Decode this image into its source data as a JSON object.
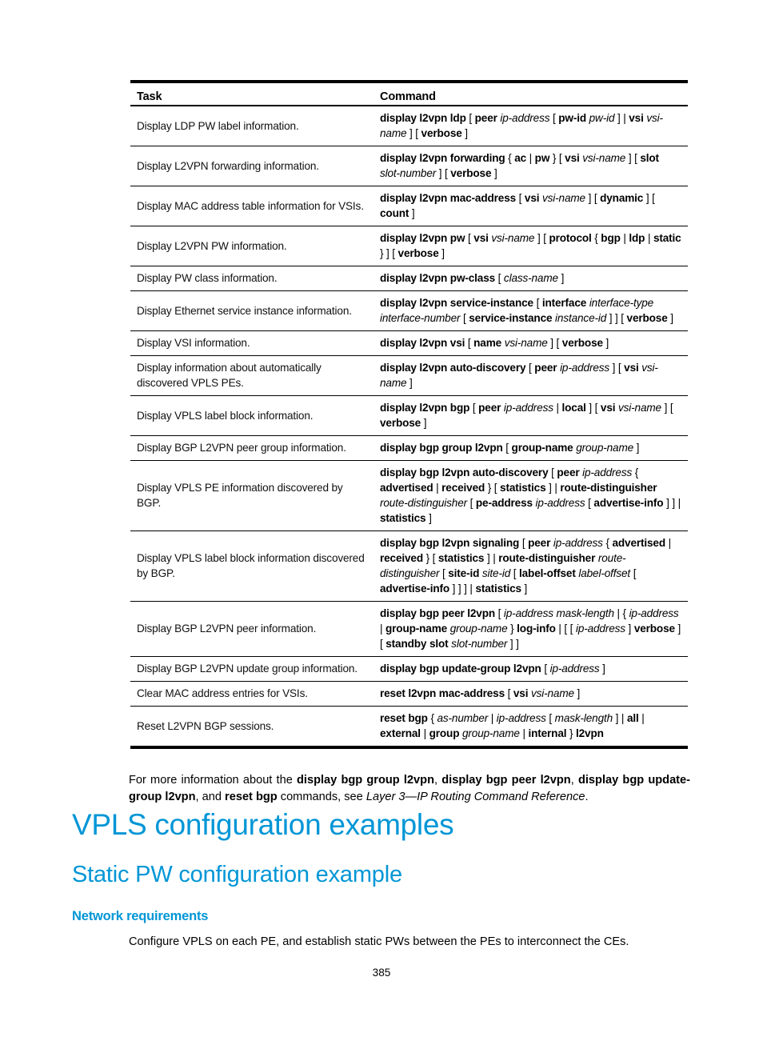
{
  "table": {
    "headers": {
      "task": "Task",
      "command": "Command"
    },
    "rows": [
      {
        "task": "Display LDP PW label information.",
        "command": [
          [
            "b",
            "display l2vpn ldp"
          ],
          [
            "t",
            " [ "
          ],
          [
            "b",
            "peer"
          ],
          [
            "t",
            " "
          ],
          [
            "i",
            "ip-address"
          ],
          [
            "t",
            " [ "
          ],
          [
            "b",
            "pw-id"
          ],
          [
            "t",
            " "
          ],
          [
            "i",
            "pw-id"
          ],
          [
            "t",
            " ] | "
          ],
          [
            "b",
            "vsi"
          ],
          [
            "t",
            " "
          ],
          [
            "i",
            "vsi-name"
          ],
          [
            "t",
            " ] [ "
          ],
          [
            "b",
            "verbose"
          ],
          [
            "t",
            " ]"
          ]
        ]
      },
      {
        "task": "Display L2VPN forwarding information.",
        "command": [
          [
            "b",
            "display l2vpn forwarding"
          ],
          [
            "t",
            " { "
          ],
          [
            "b",
            "ac"
          ],
          [
            "t",
            " | "
          ],
          [
            "b",
            "pw"
          ],
          [
            "t",
            " } [ "
          ],
          [
            "b",
            "vsi"
          ],
          [
            "t",
            " "
          ],
          [
            "i",
            "vsi-name"
          ],
          [
            "t",
            " ] [ "
          ],
          [
            "b",
            "slot"
          ],
          [
            "t",
            " "
          ],
          [
            "i",
            "slot-number"
          ],
          [
            "t",
            " ] [ "
          ],
          [
            "b",
            "verbose"
          ],
          [
            "t",
            " ]"
          ]
        ]
      },
      {
        "task": "Display MAC address table information for VSIs.",
        "command": [
          [
            "b",
            "display l2vpn mac-address"
          ],
          [
            "t",
            " [ "
          ],
          [
            "b",
            "vsi"
          ],
          [
            "t",
            " "
          ],
          [
            "i",
            "vsi-name"
          ],
          [
            "t",
            " ] [ "
          ],
          [
            "b",
            "dynamic"
          ],
          [
            "t",
            " ] [ "
          ],
          [
            "b",
            "count"
          ],
          [
            "t",
            " ]"
          ]
        ]
      },
      {
        "task": "Display L2VPN PW information.",
        "command": [
          [
            "b",
            "display l2vpn pw"
          ],
          [
            "t",
            " [ "
          ],
          [
            "b",
            "vsi"
          ],
          [
            "t",
            " "
          ],
          [
            "i",
            "vsi-name"
          ],
          [
            "t",
            " ] [ "
          ],
          [
            "b",
            "protocol"
          ],
          [
            "t",
            " { "
          ],
          [
            "b",
            "bgp"
          ],
          [
            "t",
            " | "
          ],
          [
            "b",
            "ldp"
          ],
          [
            "t",
            " | "
          ],
          [
            "b",
            "static"
          ],
          [
            "t",
            " } ] [ "
          ],
          [
            "b",
            "verbose"
          ],
          [
            "t",
            " ]"
          ]
        ]
      },
      {
        "task": "Display PW class information.",
        "command": [
          [
            "b",
            "display l2vpn pw-class"
          ],
          [
            "t",
            " [ "
          ],
          [
            "i",
            "class-name"
          ],
          [
            "t",
            " ]"
          ]
        ]
      },
      {
        "task": "Display Ethernet service instance information.",
        "command": [
          [
            "b",
            "display l2vpn service-instance"
          ],
          [
            "t",
            " [ "
          ],
          [
            "b",
            "interface"
          ],
          [
            "t",
            " "
          ],
          [
            "i",
            "interface-type interface-number"
          ],
          [
            "t",
            " [ "
          ],
          [
            "b",
            "service-instance"
          ],
          [
            "t",
            " "
          ],
          [
            "i",
            "instance-id"
          ],
          [
            "t",
            " ] ] [ "
          ],
          [
            "b",
            "verbose"
          ],
          [
            "t",
            " ]"
          ]
        ]
      },
      {
        "task": "Display VSI information.",
        "command": [
          [
            "b",
            "display l2vpn vsi"
          ],
          [
            "t",
            " [ "
          ],
          [
            "b",
            "name"
          ],
          [
            "t",
            " "
          ],
          [
            "i",
            "vsi-name"
          ],
          [
            "t",
            " ] [ "
          ],
          [
            "b",
            "verbose"
          ],
          [
            "t",
            " ]"
          ]
        ]
      },
      {
        "task": "Display information about automatically discovered VPLS PEs.",
        "command": [
          [
            "b",
            "display l2vpn auto-discovery"
          ],
          [
            "t",
            " [ "
          ],
          [
            "b",
            "peer"
          ],
          [
            "t",
            " "
          ],
          [
            "i",
            "ip-address"
          ],
          [
            "t",
            " ] [ "
          ],
          [
            "b",
            "vsi"
          ],
          [
            "t",
            " "
          ],
          [
            "i",
            "vsi-name"
          ],
          [
            "t",
            " ]"
          ]
        ]
      },
      {
        "task": "Display VPLS label block information.",
        "command": [
          [
            "b",
            "display l2vpn bgp"
          ],
          [
            "t",
            " [ "
          ],
          [
            "b",
            "peer"
          ],
          [
            "t",
            " "
          ],
          [
            "i",
            "ip-address"
          ],
          [
            "t",
            " | "
          ],
          [
            "b",
            "local"
          ],
          [
            "t",
            " ] [ "
          ],
          [
            "b",
            "vsi"
          ],
          [
            "t",
            " "
          ],
          [
            "i",
            "vsi-name"
          ],
          [
            "t",
            " ] [ "
          ],
          [
            "b",
            "verbose"
          ],
          [
            "t",
            " ]"
          ]
        ]
      },
      {
        "task": "Display BGP L2VPN peer group information.",
        "command": [
          [
            "b",
            "display bgp group l2vpn"
          ],
          [
            "t",
            " [ "
          ],
          [
            "b",
            "group-name"
          ],
          [
            "t",
            " "
          ],
          [
            "i",
            "group-name"
          ],
          [
            "t",
            " ]"
          ]
        ]
      },
      {
        "task": "Display VPLS PE information discovered by BGP.",
        "command": [
          [
            "b",
            "display bgp l2vpn auto-discovery"
          ],
          [
            "t",
            " [ "
          ],
          [
            "b",
            "peer"
          ],
          [
            "t",
            " "
          ],
          [
            "i",
            "ip-address"
          ],
          [
            "t",
            " { "
          ],
          [
            "b",
            "advertised"
          ],
          [
            "t",
            " | "
          ],
          [
            "b",
            "received"
          ],
          [
            "t",
            " } [ "
          ],
          [
            "b",
            "statistics"
          ],
          [
            "t",
            " ] | "
          ],
          [
            "b",
            "route-distinguisher"
          ],
          [
            "t",
            " "
          ],
          [
            "i",
            "route-distinguisher"
          ],
          [
            "t",
            " [ "
          ],
          [
            "b",
            "pe-address"
          ],
          [
            "t",
            " "
          ],
          [
            "i",
            "ip-address"
          ],
          [
            "t",
            " [ "
          ],
          [
            "b",
            "advertise-info"
          ],
          [
            "t",
            " ] ] | "
          ],
          [
            "b",
            "statistics"
          ],
          [
            "t",
            " ]"
          ]
        ]
      },
      {
        "task": "Display VPLS label block information discovered by BGP.",
        "command": [
          [
            "b",
            "display bgp l2vpn signaling"
          ],
          [
            "t",
            " [ "
          ],
          [
            "b",
            "peer"
          ],
          [
            "t",
            " "
          ],
          [
            "i",
            "ip-address"
          ],
          [
            "t",
            " { "
          ],
          [
            "b",
            "advertised"
          ],
          [
            "t",
            " | "
          ],
          [
            "b",
            "received"
          ],
          [
            "t",
            " } [ "
          ],
          [
            "b",
            "statistics"
          ],
          [
            "t",
            " ] | "
          ],
          [
            "b",
            "route-distinguisher"
          ],
          [
            "t",
            " "
          ],
          [
            "i",
            "route-distinguisher"
          ],
          [
            "t",
            " [ "
          ],
          [
            "b",
            "site-id"
          ],
          [
            "t",
            " "
          ],
          [
            "i",
            "site-id"
          ],
          [
            "t",
            " [ "
          ],
          [
            "b",
            "label-offset"
          ],
          [
            "t",
            " "
          ],
          [
            "i",
            "label-offset"
          ],
          [
            "t",
            " [ "
          ],
          [
            "b",
            "advertise-info"
          ],
          [
            "t",
            " ] ] ] | "
          ],
          [
            "b",
            "statistics"
          ],
          [
            "t",
            " ]"
          ]
        ]
      },
      {
        "task": "Display BGP L2VPN peer information.",
        "command": [
          [
            "b",
            "display bgp peer l2vpn"
          ],
          [
            "t",
            " [ "
          ],
          [
            "i",
            "ip-address mask-length"
          ],
          [
            "t",
            " | { "
          ],
          [
            "i",
            "ip-address"
          ],
          [
            "t",
            " | "
          ],
          [
            "b",
            "group-name"
          ],
          [
            "t",
            " "
          ],
          [
            "i",
            "group-name"
          ],
          [
            "t",
            " } "
          ],
          [
            "b",
            "log-info"
          ],
          [
            "t",
            " | [ [ "
          ],
          [
            "i",
            "ip-address"
          ],
          [
            "t",
            " ] "
          ],
          [
            "b",
            "verbose"
          ],
          [
            "t",
            " ] [ "
          ],
          [
            "b",
            "standby slot"
          ],
          [
            "t",
            " "
          ],
          [
            "i",
            "slot-number"
          ],
          [
            "t",
            " ] ]"
          ]
        ]
      },
      {
        "task": "Display BGP L2VPN update group information.",
        "command": [
          [
            "b",
            "display bgp update-group l2vpn"
          ],
          [
            "t",
            " [ "
          ],
          [
            "i",
            "ip-address"
          ],
          [
            "t",
            " ]"
          ]
        ]
      },
      {
        "task": "Clear MAC address entries for VSIs.",
        "command": [
          [
            "b",
            "reset l2vpn mac-address"
          ],
          [
            "t",
            " [ "
          ],
          [
            "b",
            "vsi"
          ],
          [
            "t",
            " "
          ],
          [
            "i",
            "vsi-name"
          ],
          [
            "t",
            " ]"
          ]
        ]
      },
      {
        "task": "Reset L2VPN BGP sessions.",
        "command": [
          [
            "b",
            "reset bgp"
          ],
          [
            "t",
            " { "
          ],
          [
            "i",
            "as-number"
          ],
          [
            "t",
            " | "
          ],
          [
            "i",
            "ip-address"
          ],
          [
            "t",
            " [ "
          ],
          [
            "i",
            "mask-length"
          ],
          [
            "t",
            " ] | "
          ],
          [
            "b",
            "all"
          ],
          [
            "t",
            " | "
          ],
          [
            "b",
            "external"
          ],
          [
            "t",
            " | "
          ],
          [
            "b",
            "group"
          ],
          [
            "t",
            " "
          ],
          [
            "i",
            "group-name"
          ],
          [
            "t",
            " | "
          ],
          [
            "b",
            "internal"
          ],
          [
            "t",
            " } "
          ],
          [
            "b",
            "l2vpn"
          ]
        ]
      }
    ]
  },
  "note": [
    [
      "t",
      "For more information about the "
    ],
    [
      "b",
      "display bgp group l2vpn"
    ],
    [
      "t",
      ", "
    ],
    [
      "b",
      "display bgp peer l2vpn"
    ],
    [
      "t",
      ", "
    ],
    [
      "b",
      "display bgp update-group l2vpn"
    ],
    [
      "t",
      ", and "
    ],
    [
      "b",
      "reset bgp"
    ],
    [
      "t",
      " commands, see "
    ],
    [
      "i",
      "Layer 3—IP Routing Command Reference"
    ],
    [
      "t",
      "."
    ]
  ],
  "headings": {
    "h1": "VPLS configuration examples",
    "h2": "Static PW configuration example",
    "h3": "Network requirements"
  },
  "body_text": "Configure VPLS on each PE, and establish static PWs between the PEs to interconnect the CEs.",
  "page_number": "385",
  "colors": {
    "heading": "#0096d6"
  }
}
